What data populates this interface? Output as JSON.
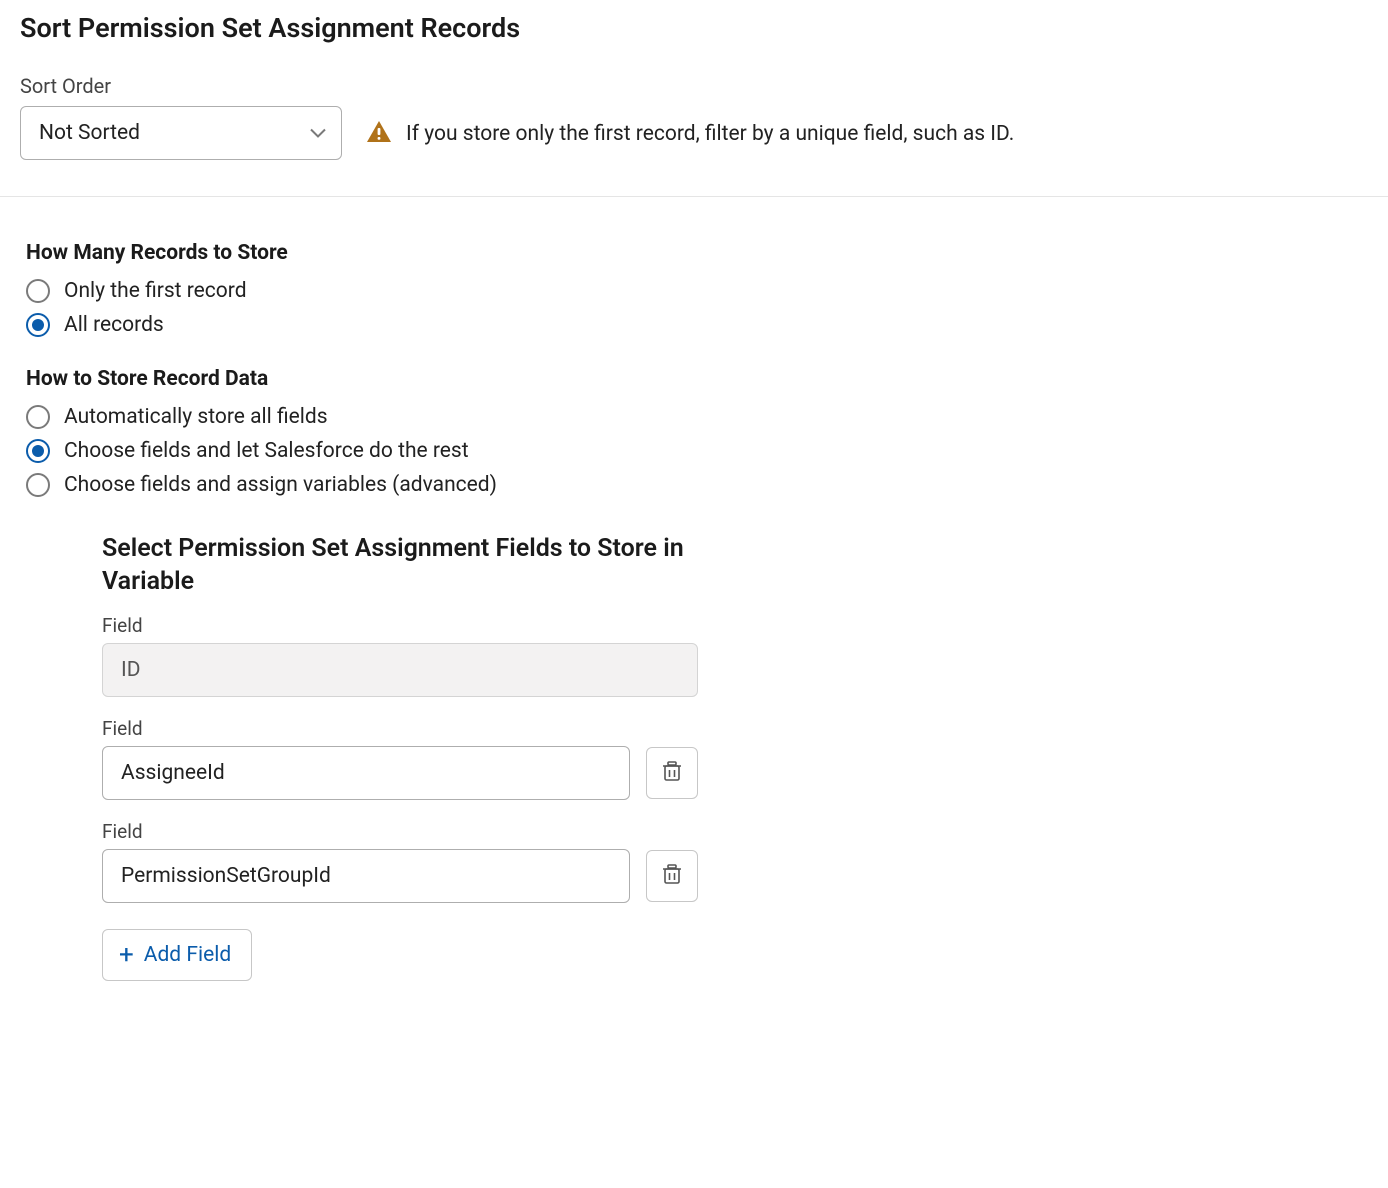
{
  "sort": {
    "title": "Sort Permission Set Assignment Records",
    "order_label": "Sort Order",
    "order_value": "Not Sorted",
    "warning_text": "If you store only the first record, filter by a unique field, such as ID."
  },
  "records_to_store": {
    "heading": "How Many Records to Store",
    "options": [
      {
        "label": "Only the first record",
        "selected": false
      },
      {
        "label": "All records",
        "selected": true
      }
    ]
  },
  "store_data": {
    "heading": "How to Store Record Data",
    "options": [
      {
        "label": "Automatically store all fields",
        "selected": false
      },
      {
        "label": "Choose fields and let Salesforce do the rest",
        "selected": true
      },
      {
        "label": "Choose fields and assign variables (advanced)",
        "selected": false
      }
    ]
  },
  "select_fields": {
    "title": "Select Permission Set Assignment Fields to Store in Variable",
    "field_label": "Field",
    "rows": [
      {
        "value": "ID",
        "readonly": true,
        "deletable": false
      },
      {
        "value": "AssigneeId",
        "readonly": false,
        "deletable": true
      },
      {
        "value": "PermissionSetGroupId",
        "readonly": false,
        "deletable": true
      }
    ],
    "add_label": "Add Field"
  }
}
